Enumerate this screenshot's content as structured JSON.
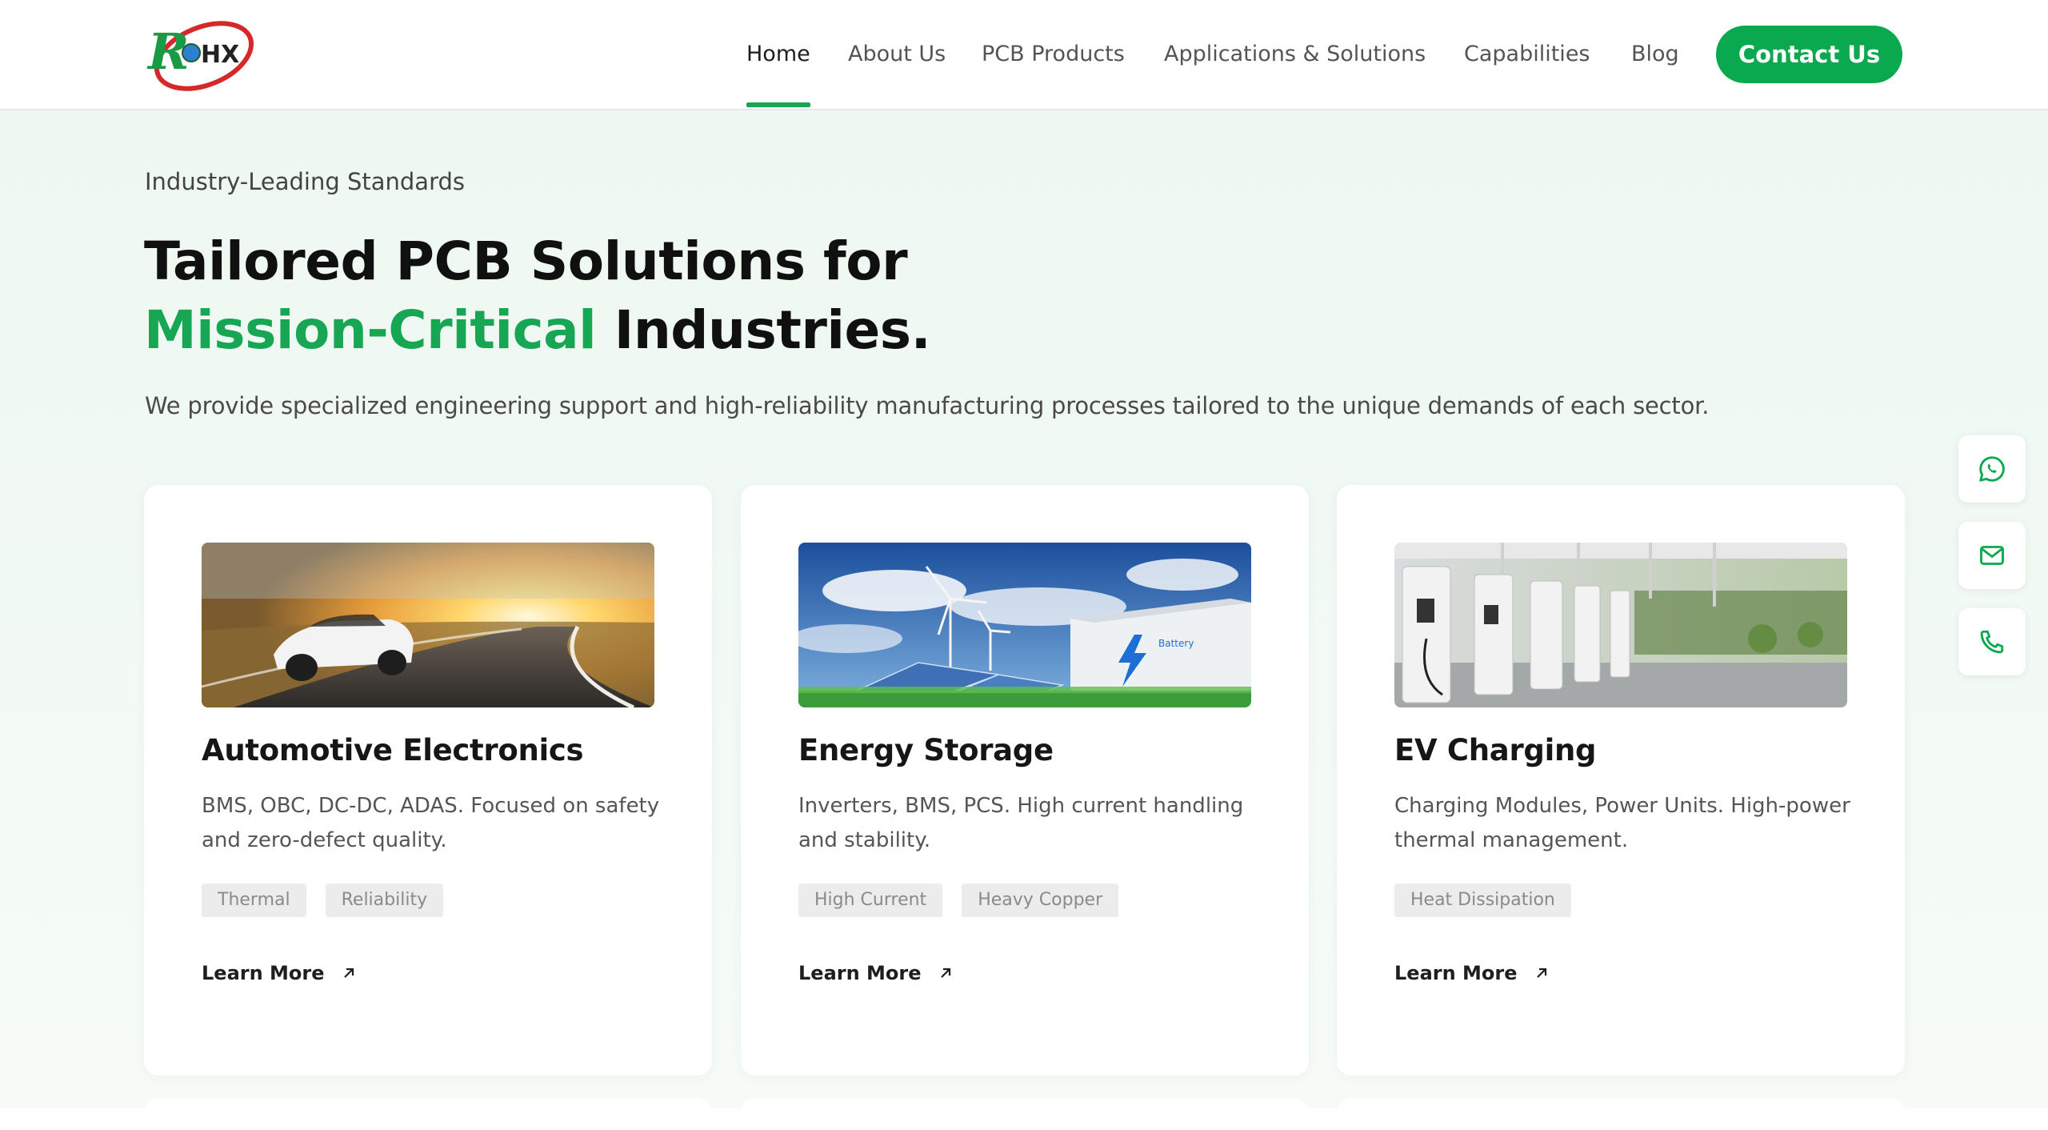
{
  "brand": {
    "logo_text": "RoHX"
  },
  "nav": {
    "items": [
      {
        "label": "Home",
        "active": true
      },
      {
        "label": "About Us"
      },
      {
        "label": "PCB Products"
      },
      {
        "label": "Applications & Solutions"
      },
      {
        "label": "Capabilities"
      },
      {
        "label": "Blog"
      }
    ],
    "contact_label": "Contact Us"
  },
  "hero": {
    "eyebrow": "Industry-Leading Standards",
    "headline_line1": "Tailored PCB Solutions for",
    "headline_green": "Mission-Critical",
    "headline_rest": " Industries.",
    "intro": "We provide specialized engineering support and high-reliability manufacturing processes tailored to the unique demands of each sector."
  },
  "cards": [
    {
      "title": "Automotive Electronics",
      "desc": "BMS, OBC, DC-DC, ADAS. Focused on safety and zero-defect quality.",
      "tags": [
        "Thermal",
        "Reliability"
      ],
      "link": "Learn More",
      "image": "car-on-road"
    },
    {
      "title": "Energy Storage",
      "desc": "Inverters, BMS, PCS. High current handling and stability.",
      "tags": [
        "High Current",
        "Heavy Copper"
      ],
      "link": "Learn More",
      "image": "battery-wind-solar",
      "image_text": "Battery"
    },
    {
      "title": "EV Charging",
      "desc": "Charging Modules, Power Units. High-power thermal management.",
      "tags": [
        "Heat Dissipation"
      ],
      "link": "Learn More",
      "image": "charging-stations"
    }
  ],
  "floating": [
    "whatsapp-icon",
    "mail-icon",
    "phone-icon"
  ],
  "colors": {
    "accent": "#0aa84f",
    "heading_green": "#17a653",
    "nav_text": "#545454"
  }
}
